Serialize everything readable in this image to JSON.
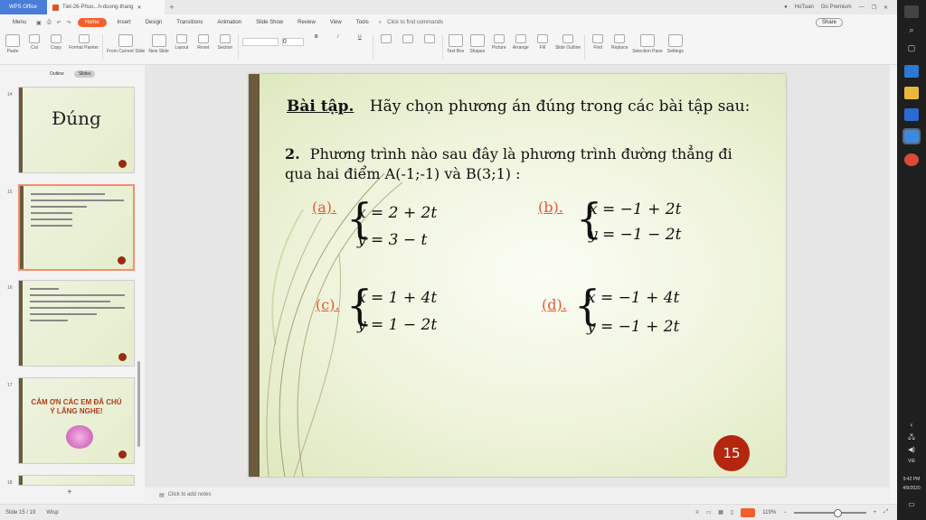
{
  "tabbar": {
    "app_label": "WPS Office",
    "doc_tab": "Tiet-26-Phuo...h-duong-thang",
    "plus": "+",
    "user": "HoTuan",
    "premium": "Go Premium"
  },
  "menubar": {
    "menu": "Menu",
    "items": [
      "Home",
      "Insert",
      "Design",
      "Transitions",
      "Animation",
      "Slide Show",
      "Review",
      "View",
      "Tools"
    ],
    "search": "Click to find commands",
    "share": "Share"
  },
  "toolbar": {
    "paste": "Paste",
    "cut": "Cut",
    "copy": "Copy",
    "format_painter": "Format Painter",
    "from_current": "From Current Slide",
    "new_slide": "New Slide",
    "layout": "Layout",
    "reset": "Reset",
    "section": "Section",
    "font_size": "0",
    "textbox": "Text Box",
    "shapes": "Shapes",
    "picture": "Picture",
    "arrange": "Arrange",
    "fill": "Fill",
    "slide_outline": "Slide Outline",
    "find": "Find",
    "replace": "Replace",
    "selection_pane": "Selection Pane",
    "settings": "Settings"
  },
  "panel": {
    "tab_outline": "Outline",
    "tab_slides": "Slides",
    "thumbs": [
      {
        "num": "14",
        "title": "Đúng"
      },
      {
        "num": "15"
      },
      {
        "num": "16"
      },
      {
        "num": "17",
        "text": "CẢM ƠN CÁC EM ĐÃ CHÚ Ý LẮNG NGHE!"
      },
      {
        "num": "18"
      }
    ],
    "add": "+"
  },
  "slide": {
    "heading_label": "Bài tập.",
    "heading_text": "Hãy chọn phương án đúng trong các bài tập sau:",
    "q_num": "2.",
    "q_text": "Phương trình nào sau đây là phương trình đường thẳng đi qua hai điểm A(-1;-1) và B(3;1) :",
    "options": [
      {
        "label": "(a).",
        "eq1": "x = 2 + 2t",
        "eq2": "y = 3 − t"
      },
      {
        "label": "(b).",
        "eq1": "x = −1 + 2t",
        "eq2": "y = −1 − 2t"
      },
      {
        "label": "(c).",
        "eq1": "x = 1 + 4t",
        "eq2": "y = 1 − 2t"
      },
      {
        "label": "(d).",
        "eq1": "x = −1 + 4t",
        "eq2": "y = −1 + 2t"
      }
    ],
    "page_number": "15"
  },
  "notes": {
    "placeholder": "Click to add notes"
  },
  "status": {
    "slide": "Slide 15 / 19",
    "theme": "Wisp",
    "zoom": "119%"
  },
  "taskbar": {
    "time": "9:42 PM",
    "date": "4/9/2020",
    "lang": "VIE"
  },
  "colors": {
    "accent": "#f1602c",
    "wps_blue": "#4a7cd9",
    "slide_bar": "#6b5a3e",
    "option_label": "#e05a32",
    "page_circle": "#b3260f"
  }
}
